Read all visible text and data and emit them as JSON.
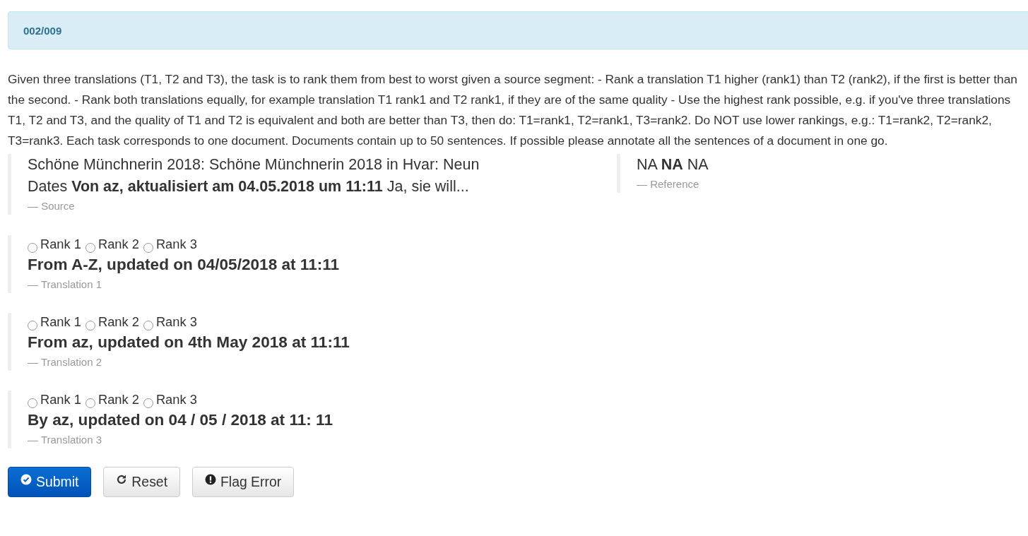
{
  "banner": {
    "title": "002/009"
  },
  "instructions": "Given three translations (T1, T2 and T3), the task is to rank them from best to worst given a source segment: - Rank a translation T1 higher (rank1) than T2 (rank2), if the first is better than the second. - Rank both translations equally, for example translation T1 rank1 and T2 rank1, if they are of the same quality - Use the highest rank possible, e.g. if you've three translations T1, T2 and T3, and the quality of T1 and T2 is equivalent and both are better than T3, then do: T1=rank1, T2=rank1, T3=rank2. Do NOT use lower rankings, e.g.: T1=rank2, T2=rank2, T3=rank3. Each task corresponds to one document. Documents contain up to 50 sentences. If possible please annotate all the sentences of a document in one go.",
  "source": {
    "text": "Schöne Münchnerin 2018: Schöne Münchnerin 2018 in Hvar: Neun Dates **Von az, aktualisiert am 04.05.2018 um 11:11** Ja, sie will...",
    "caption": "— Source"
  },
  "reference": {
    "text": "NA **NA** NA",
    "caption": "— Reference"
  },
  "translations": [
    {
      "options": [
        {
          "label": "Rank 1",
          "selected": false
        },
        {
          "label": "Rank 2",
          "selected": false
        },
        {
          "label": "Rank 3",
          "selected": false
        }
      ],
      "text": "From A-Z, updated on 04/05/2018 at 11:11",
      "caption": "— Translation 1"
    },
    {
      "options": [
        {
          "label": "Rank 1",
          "selected": false
        },
        {
          "label": "Rank 2",
          "selected": false
        },
        {
          "label": "Rank 3",
          "selected": false
        }
      ],
      "text": "From az, updated on 4th May 2018 at 11:11",
      "caption": "— Translation 2"
    },
    {
      "options": [
        {
          "label": "Rank 1",
          "selected": false
        },
        {
          "label": "Rank 2",
          "selected": false
        },
        {
          "label": "Rank 3",
          "selected": false
        }
      ],
      "text": "By az, updated on 04 / 05 / 2018 at 11: 11",
      "caption": "— Translation 3"
    }
  ],
  "buttons": [
    {
      "kind": "primary",
      "label": "Submit"
    },
    {
      "kind": "default",
      "label": "Reset"
    },
    {
      "kind": "default",
      "label": "Flag Error"
    }
  ]
}
